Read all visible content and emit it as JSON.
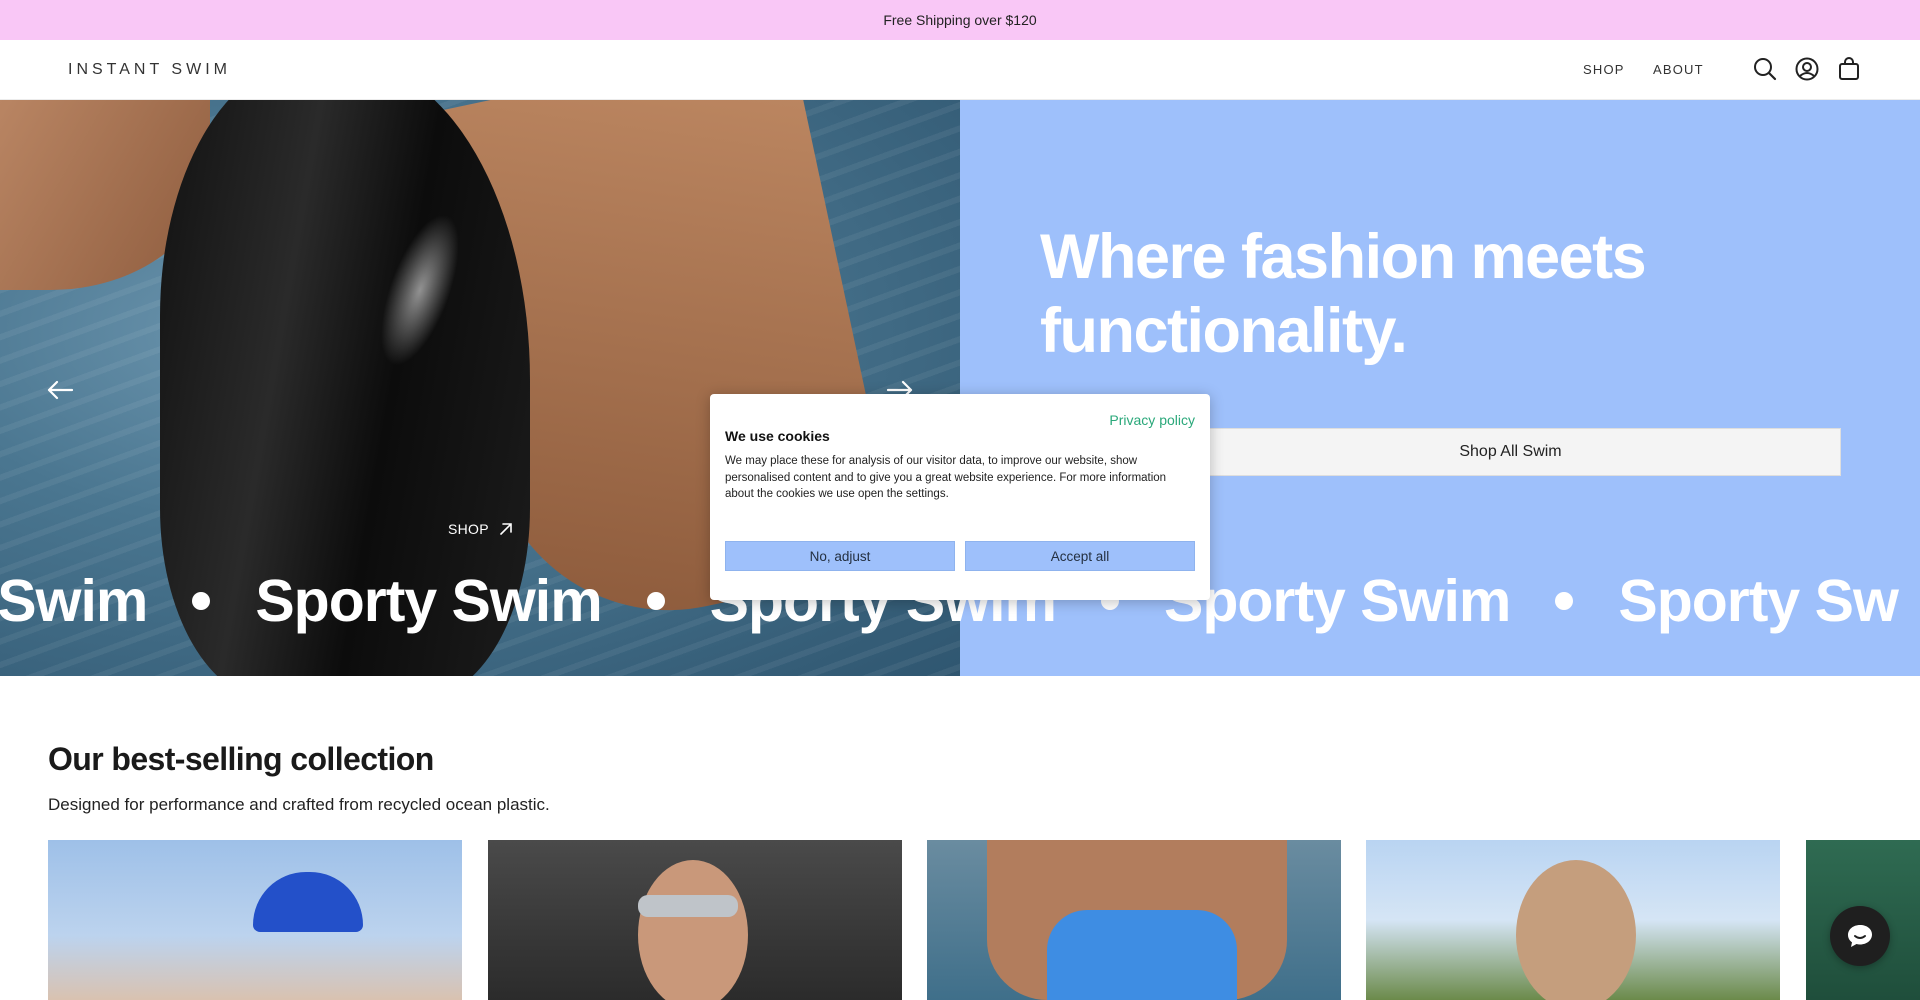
{
  "announcement": {
    "text": "Free Shipping over $120"
  },
  "header": {
    "logo": "INSTANT SWIM",
    "nav": [
      {
        "label": "SHOP"
      },
      {
        "label": "ABOUT"
      }
    ],
    "icons": [
      "search-icon",
      "account-icon",
      "cart-icon"
    ]
  },
  "hero": {
    "title": "Where fashion meets functionality.",
    "cta_label": "Shop All Swim",
    "shop_link": "SHOP",
    "marquee": [
      "y Swim",
      "Sporty Swim",
      "Sporty Swim",
      "Sporty Swim",
      "Sporty Sw"
    ],
    "colors": {
      "panel": "#9ec0fb",
      "announcement": "#f9c7f6"
    }
  },
  "cookie": {
    "privacy_link": "Privacy policy",
    "title": "We use cookies",
    "body": "We may place these for analysis of our visitor data, to improve our website, show personalised content and to give you a great website experience. For more information about the cookies we use open the settings.",
    "no_label": "No, adjust",
    "accept_label": "Accept all"
  },
  "collection": {
    "title": "Our best-selling collection",
    "subtitle": "Designed for performance and crafted from recycled ocean plastic."
  },
  "chat": {
    "icon": "chat-icon"
  }
}
